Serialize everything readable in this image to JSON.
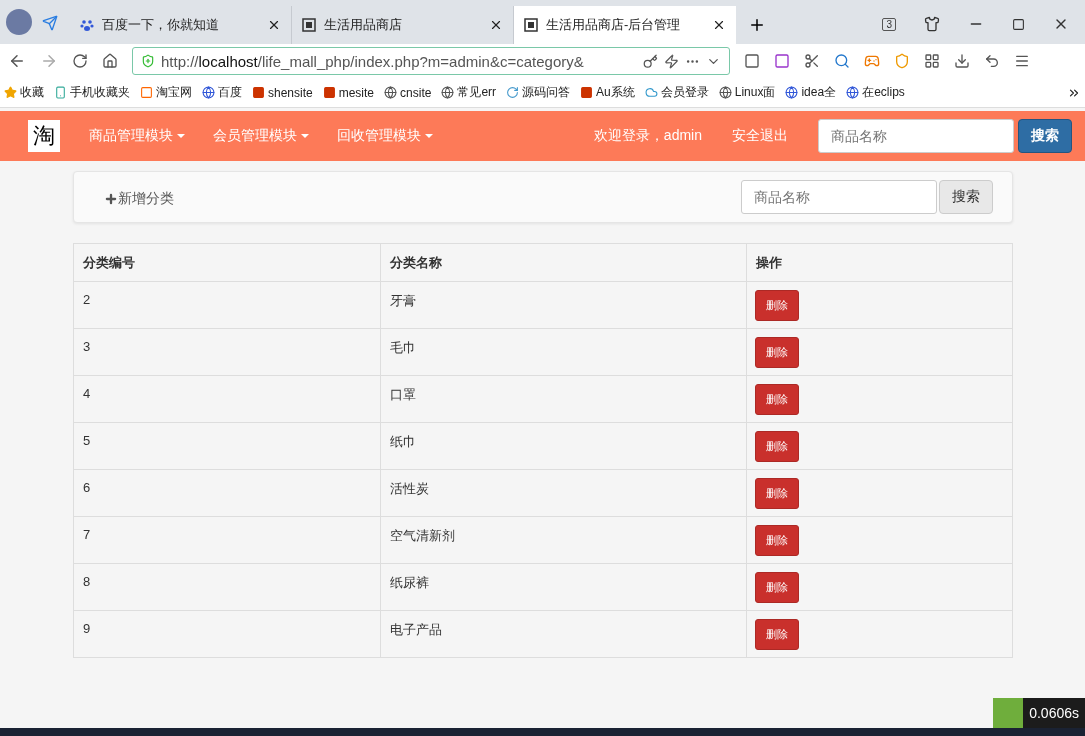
{
  "browser": {
    "tabs": [
      {
        "title": "百度一下，你就知道",
        "kind": "baidu",
        "selected": false
      },
      {
        "title": "生活用品商店",
        "kind": "tao",
        "selected": false
      },
      {
        "title": "生活用品商店-后台管理",
        "kind": "tao",
        "selected": true
      }
    ],
    "tab_count": "3",
    "address": {
      "prefix": "http://",
      "host": "localhost",
      "path": "/life_mall_php/index.php?m=admin&c=category&"
    },
    "bookmarks": [
      {
        "label": "收藏",
        "kind": "star"
      },
      {
        "label": "手机收藏夹",
        "kind": "phone"
      },
      {
        "label": "淘宝网",
        "kind": "tao"
      },
      {
        "label": "百度",
        "kind": "baidu"
      },
      {
        "label": "shensite",
        "kind": "square"
      },
      {
        "label": "mesite",
        "kind": "square"
      },
      {
        "label": "cnsite",
        "kind": "globe"
      },
      {
        "label": "常见err",
        "kind": "globe"
      },
      {
        "label": "源码问答",
        "kind": "swirl"
      },
      {
        "label": "Au系统",
        "kind": "square"
      },
      {
        "label": "会员登录",
        "kind": "cloud"
      },
      {
        "label": "Linux面",
        "kind": "globe"
      },
      {
        "label": "idea全",
        "kind": "baidu"
      },
      {
        "label": "在eclips",
        "kind": "baidu"
      }
    ]
  },
  "navbar": {
    "logo": "淘",
    "menus": [
      "商品管理模块",
      "会员管理模块",
      "回收管理模块"
    ],
    "welcome": "欢迎登录，admin",
    "logout": "安全退出",
    "search": {
      "placeholder": "商品名称",
      "button": "搜索"
    }
  },
  "toolbar": {
    "add": "新增分类",
    "search": {
      "placeholder": "商品名称",
      "button": "搜索"
    }
  },
  "table": {
    "columns": [
      "分类编号",
      "分类名称",
      "操作"
    ],
    "rows": [
      {
        "id": "2",
        "name": "牙膏",
        "action": "删除"
      },
      {
        "id": "3",
        "name": "毛巾",
        "action": "删除"
      },
      {
        "id": "4",
        "name": "口罩",
        "action": "删除"
      },
      {
        "id": "5",
        "name": "纸巾",
        "action": "删除"
      },
      {
        "id": "6",
        "name": "活性炭",
        "action": "删除"
      },
      {
        "id": "7",
        "name": "空气清新剂",
        "action": "删除"
      },
      {
        "id": "8",
        "name": "纸尿裤",
        "action": "删除"
      },
      {
        "id": "9",
        "name": "电子产品",
        "action": "删除"
      }
    ]
  },
  "timer": "0.0606s"
}
